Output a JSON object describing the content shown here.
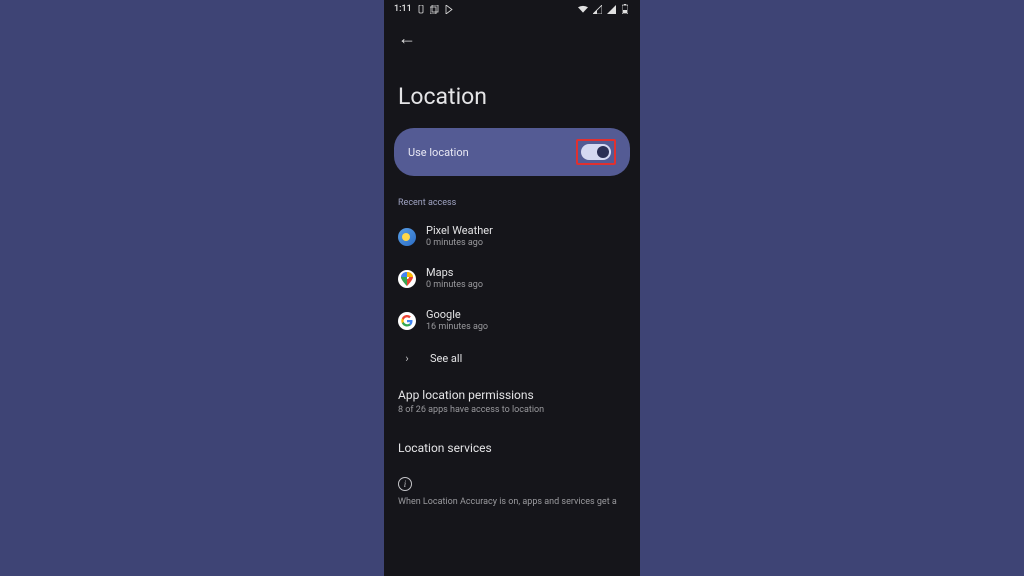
{
  "status_bar": {
    "time": "1:11"
  },
  "page": {
    "title": "Location"
  },
  "toggle": {
    "label": "Use location",
    "enabled": true
  },
  "recent": {
    "header": "Recent access",
    "apps": [
      {
        "name": "Pixel Weather",
        "time": "0 minutes ago"
      },
      {
        "name": "Maps",
        "time": "0 minutes ago"
      },
      {
        "name": "Google",
        "time": "16 minutes ago"
      }
    ],
    "see_all": "See all"
  },
  "settings": {
    "permissions_title": "App location permissions",
    "permissions_sub": "8 of 26 apps have access to location",
    "services_title": "Location services"
  },
  "info": {
    "text": "When Location Accuracy is on, apps and services get a"
  }
}
